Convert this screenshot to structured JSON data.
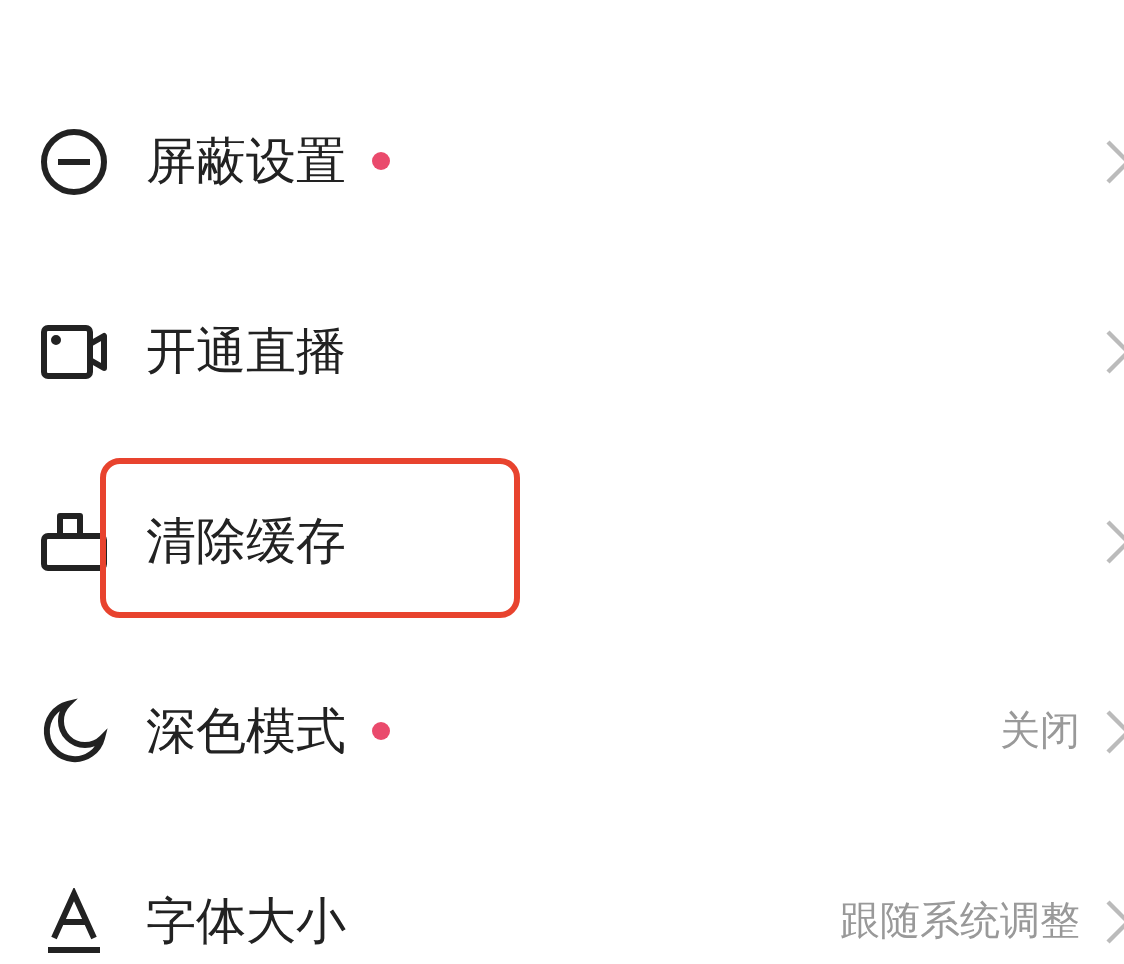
{
  "settings": [
    {
      "kind": "block",
      "label": "屏蔽设置",
      "dot": true,
      "highlighted": false
    },
    {
      "kind": "video",
      "label": "开通直播",
      "dot": false,
      "highlighted": false
    },
    {
      "kind": "bag",
      "label": "清除缓存",
      "dot": false,
      "highlighted": true
    },
    {
      "kind": "moon",
      "label": "深色模式",
      "dot": true,
      "value": "关闭",
      "highlighted": false
    },
    {
      "kind": "font",
      "label": "字体大小",
      "dot": false,
      "value": "跟随系统调整",
      "highlighted": false
    }
  ]
}
